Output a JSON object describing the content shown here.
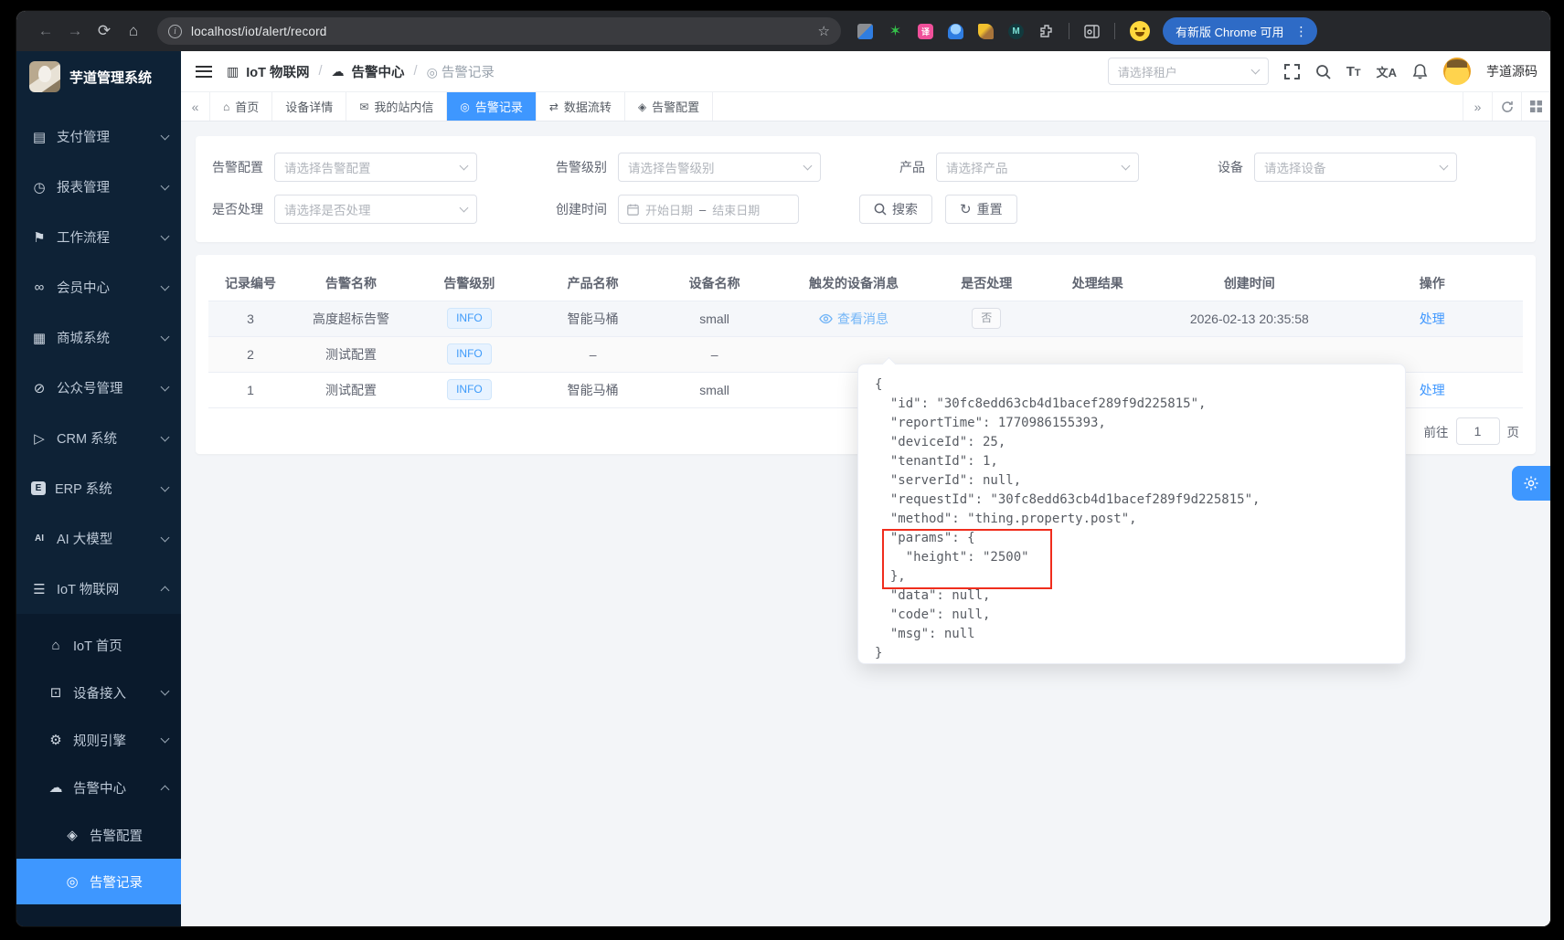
{
  "colors": {
    "accent": "#3e97ff",
    "sidebar_bg": "#0e2236",
    "sidebar_submenu_bg": "#0a1a2c",
    "chrome_bar_bg": "#26282c",
    "content_bg": "#f3f5f8",
    "info_tag_text": "#3f9bfa",
    "red_highlight_box": "#f02d1d",
    "update_chip_bg": "#2e6bc6"
  },
  "browser": {
    "url": "localhost/iot/alert/record",
    "update_chip": "有新版 Chrome 可用"
  },
  "sidebar": {
    "logo_title": "芋道管理系统",
    "items": [
      {
        "glyph": "▤",
        "label": "支付管理"
      },
      {
        "glyph": "◷",
        "label": "报表管理"
      },
      {
        "glyph": "⚑",
        "label": "工作流程"
      },
      {
        "glyph": "∞",
        "label": "会员中心"
      },
      {
        "glyph": "▦",
        "label": "商城系统"
      },
      {
        "glyph": "⊘",
        "label": "公众号管理"
      },
      {
        "glyph": "▷",
        "label": "CRM 系统"
      },
      {
        "glyph": "E",
        "label": "ERP 系统"
      },
      {
        "glyph": "AI",
        "label": "AI 大模型"
      },
      {
        "glyph": "☰",
        "label": "IoT 物联网"
      }
    ],
    "iot_submenu": [
      {
        "glyph": "⌂",
        "label": "IoT 首页"
      },
      {
        "glyph": "⊡",
        "label": "设备接入"
      },
      {
        "glyph": "⚙",
        "label": "规则引擎"
      },
      {
        "glyph": "☁",
        "label": "告警中心"
      }
    ],
    "alert_submenu": [
      {
        "glyph": "◈",
        "label": "告警配置"
      },
      {
        "glyph": "◎",
        "label": "告警记录"
      }
    ]
  },
  "header": {
    "breadcrumb": [
      {
        "glyph": "▥",
        "label": "IoT 物联网"
      },
      {
        "glyph": "☁",
        "label": "告警中心"
      },
      {
        "glyph": "◎",
        "label": "告警记录"
      }
    ],
    "tenant_placeholder": "请选择租户",
    "username": "芋道源码"
  },
  "tabs": [
    {
      "glyph": "⌂",
      "label": "首页"
    },
    {
      "glyph": "",
      "label": "设备详情"
    },
    {
      "glyph": "✉",
      "label": "我的站内信"
    },
    {
      "glyph": "◎",
      "label": "告警记录"
    },
    {
      "glyph": "⇄",
      "label": "数据流转"
    },
    {
      "glyph": "◈",
      "label": "告警配置"
    }
  ],
  "filters": {
    "alert_config_label": "告警配置",
    "alert_config_placeholder": "请选择告警配置",
    "alert_level_label": "告警级别",
    "alert_level_placeholder": "请选择告警级别",
    "product_label": "产品",
    "product_placeholder": "请选择产品",
    "device_label": "设备",
    "device_placeholder": "请选择设备",
    "handled_label": "是否处理",
    "handled_placeholder": "请选择是否处理",
    "time_label": "创建时间",
    "time_start_placeholder": "开始日期",
    "time_separator": "–",
    "time_end_placeholder": "结束日期",
    "search_label": "搜索",
    "reset_label": "重置"
  },
  "table": {
    "columns": [
      "记录编号",
      "告警名称",
      "告警级别",
      "产品名称",
      "设备名称",
      "触发的设备消息",
      "是否处理",
      "处理结果",
      "创建时间",
      "操作"
    ],
    "rows": [
      {
        "id": "3",
        "name": "高度超标告警",
        "level": "INFO",
        "product": "智能马桶",
        "device": "small",
        "message_link": "查看消息",
        "handled": "否",
        "result": "",
        "created": "2026-02-13 20:35:58",
        "action": "处理"
      },
      {
        "id": "2",
        "name": "测试配置",
        "level": "INFO",
        "product": "–",
        "device": "–",
        "message_link": "",
        "handled": "",
        "result": "",
        "created": "",
        "action": ""
      },
      {
        "id": "1",
        "name": "测试配置",
        "level": "INFO",
        "product": "智能马桶",
        "device": "small",
        "message_link": "",
        "handled": "",
        "result": "",
        "created": "",
        "action": "处理"
      }
    ]
  },
  "pagination": {
    "goto_label": "前往",
    "page_value": "1",
    "page_unit": "页"
  },
  "popup": {
    "json_lines": [
      "{",
      "  \"id\": \"30fc8edd63cb4d1bacef289f9d225815\",",
      "  \"reportTime\": 1770986155393,",
      "  \"deviceId\": 25,",
      "  \"tenantId\": 1,",
      "  \"serverId\": null,",
      "  \"requestId\": \"30fc8edd63cb4d1bacef289f9d225815\",",
      "  \"method\": \"thing.property.post\",",
      "  \"params\": {",
      "    \"height\": \"2500\"",
      "  },",
      "  \"data\": null,",
      "  \"code\": null,",
      "  \"msg\": null",
      "}"
    ]
  }
}
